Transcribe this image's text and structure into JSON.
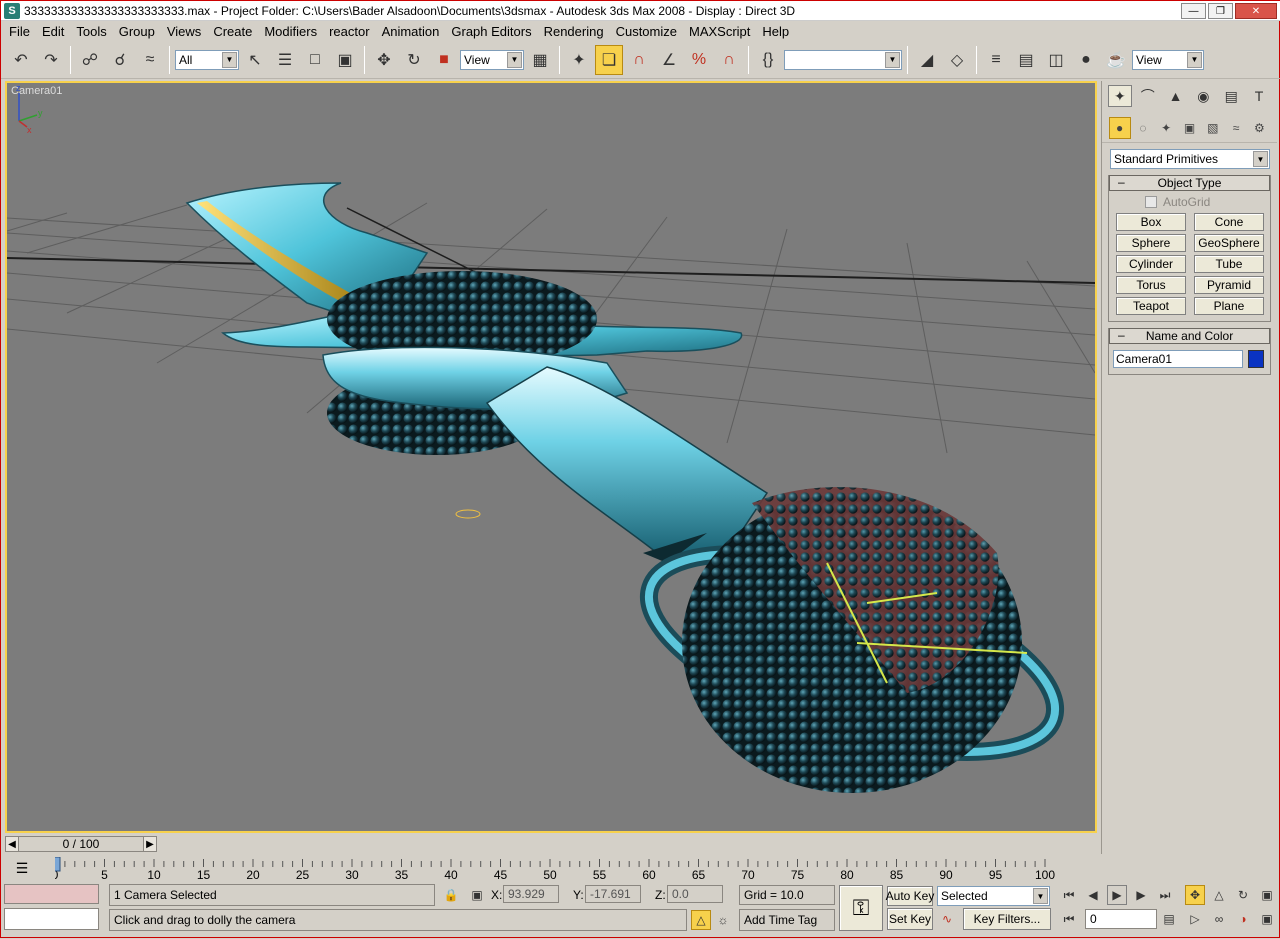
{
  "window": {
    "title": "333333333333333333333333.max     - Project Folder: C:\\Users\\Bader Alsadoon\\Documents\\3dsmax     - Autodesk 3ds Max 2008     - Display : Direct 3D",
    "app_icon": "S"
  },
  "menu": [
    "File",
    "Edit",
    "Tools",
    "Group",
    "Views",
    "Create",
    "Modifiers",
    "reactor",
    "Animation",
    "Graph Editors",
    "Rendering",
    "Customize",
    "MAXScript",
    "Help"
  ],
  "toolbar": {
    "selection_filter": "All",
    "ref_coord": "View",
    "named_selection": "",
    "viewport_ref": "View",
    "accent": "#f7d14c"
  },
  "viewport": {
    "label": "Camera01",
    "background": "#7c7c7c",
    "axis": {
      "x": "x",
      "y": "y",
      "z": "z"
    }
  },
  "command_panel": {
    "primitive_set": "Standard Primitives",
    "object_type": {
      "title": "Object Type",
      "autogrid": "AutoGrid",
      "buttons": [
        "Box",
        "Cone",
        "Sphere",
        "GeoSphere",
        "Cylinder",
        "Tube",
        "Torus",
        "Pyramid",
        "Teapot",
        "Plane"
      ]
    },
    "name_color": {
      "title": "Name and Color",
      "name": "Camera01",
      "color": "#0a33c2"
    }
  },
  "timeline": {
    "frame_display": "0 / 100",
    "ticks": [
      "0",
      "5",
      "10",
      "15",
      "20",
      "25",
      "30",
      "35",
      "40",
      "45",
      "50",
      "55",
      "60",
      "65",
      "70",
      "75",
      "80",
      "85",
      "90",
      "95",
      "100"
    ]
  },
  "status": {
    "selection_text": "1 Camera Selected",
    "prompt_text": "Click and drag to dolly the camera",
    "x_label": "X:",
    "x_value": "93.929",
    "y_label": "Y:",
    "y_value": "-17.691",
    "z_label": "Z:",
    "z_value": "0.0",
    "grid": "Grid = 10.0",
    "add_time_tag": "Add Time Tag",
    "auto_key": "Auto Key",
    "set_key": "Set Key",
    "key_mode": "Selected",
    "key_filters": "Key Filters...",
    "current_frame": "0"
  }
}
